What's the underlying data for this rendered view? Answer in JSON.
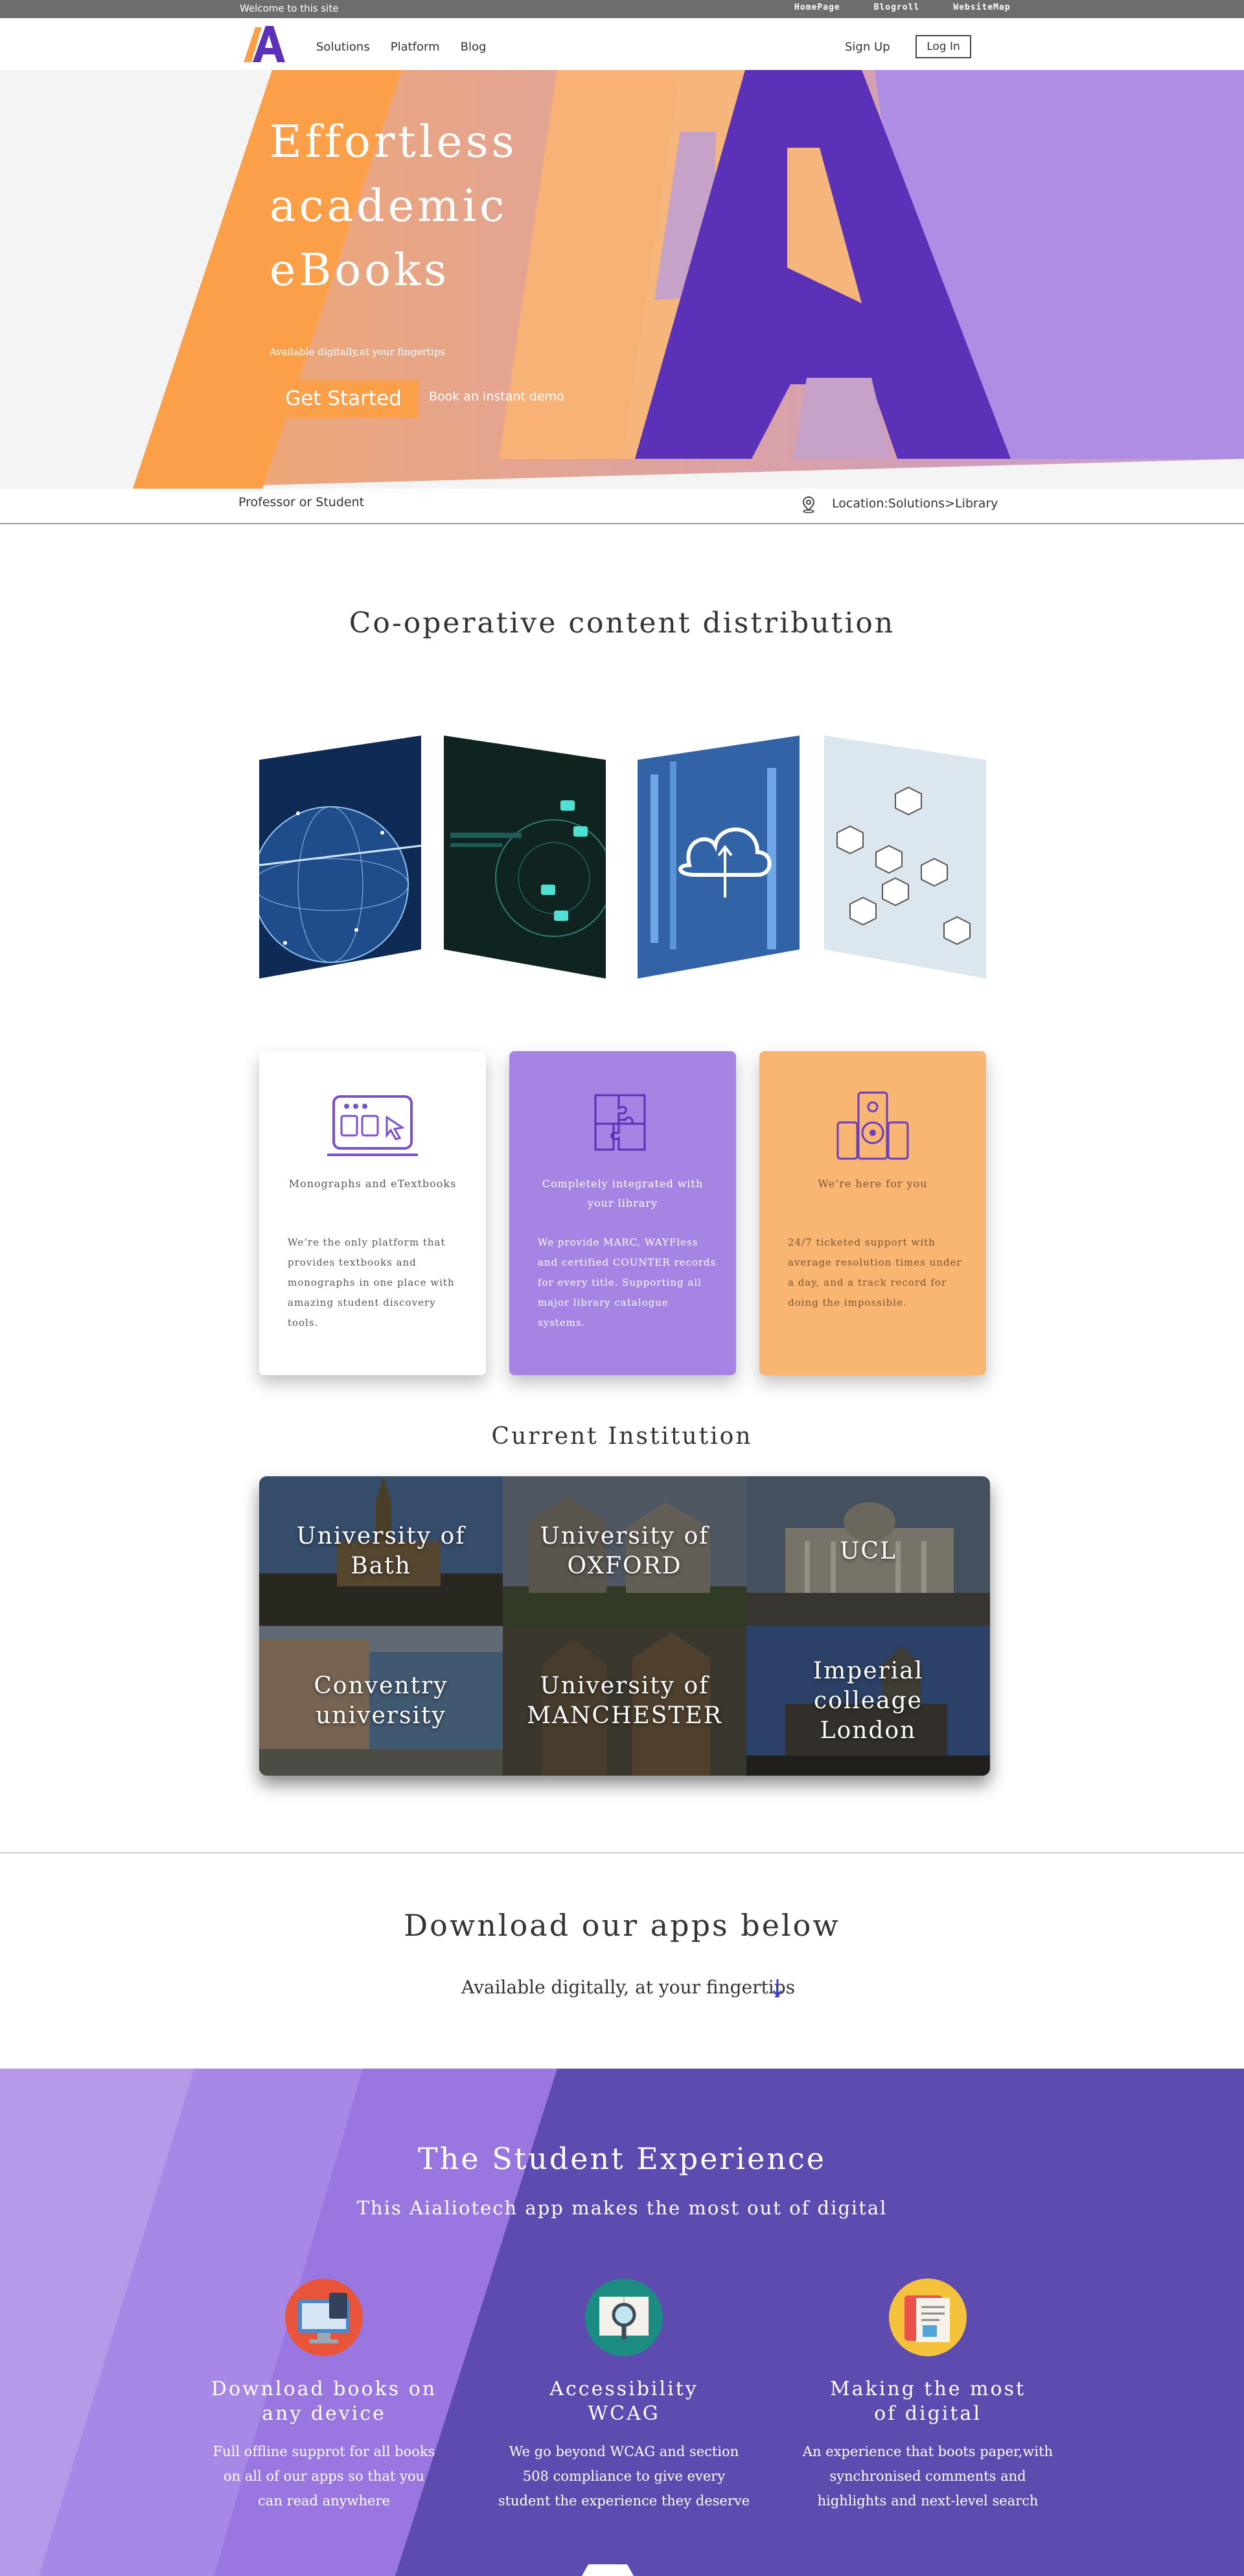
{
  "topbar": {
    "welcome": "Welcome to this site",
    "links": [
      "HomePage",
      "Blogroll",
      "WebsiteMap"
    ]
  },
  "nav": {
    "links": [
      "Solutions",
      "Platform",
      "Blog"
    ],
    "signup": "Sign Up",
    "login": "Log In"
  },
  "hero": {
    "title": "Effortless academic eBooks",
    "subtitle": "Available digitally,at your fingertips",
    "cta_primary": "Get Started",
    "cta_secondary": "Book an instant demo"
  },
  "location_bar": {
    "role": "Professor or Student",
    "location": "Location:Solutions>Library",
    "icon": "location-pin-icon"
  },
  "cooperative": {
    "title": "Co-operative content distribution"
  },
  "cards": [
    {
      "title": "Monographs and eTextbooks",
      "text": "We’re the only platform that provides textbooks and monographs in one place with amazing student discovery tools.",
      "icon": "device-browser-icon"
    },
    {
      "title": "Completely integrated with your library",
      "text": "We provide MARC, WAYFless and certified COUNTER records for every title. Supporting all major library catalogue systems.",
      "icon": "puzzle-icon"
    },
    {
      "title": "We’re here for you",
      "text": "24/7 ticketed support with average resolution times under a day, and a track record for doing the impossible.",
      "icon": "speaker-icon"
    }
  ],
  "institutions": {
    "title": "Current Institution",
    "items": [
      "University of\nBath",
      "University of\nOXFORD",
      "UCL",
      "Conventry\nuniversity",
      "University of\nMANCHESTER",
      "Imperial colleage\nLondon"
    ]
  },
  "download": {
    "title": "Download our apps below",
    "subtitle": "Available digitally, at your fingertips",
    "icon": "arrow-down-icon"
  },
  "student": {
    "title": "The Student Experience",
    "subtitle": "This Aialiotech app makes the most out of digital",
    "features": [
      {
        "title": "Download books on\nany device",
        "text": "Full offline supprot for all books\non all of our apps so that you\ncan read anywhere",
        "icon": "computer-icon"
      },
      {
        "title": "Accessibility\nWCAG",
        "text": "We go beyond WCAG and section\n508 compliance to give every\nstudent the experience they deserve",
        "icon": "magnifier-book-icon"
      },
      {
        "title": "Making the most\nof digital",
        "text": "An experience that boots paper,with\nsynchronised comments and\nhighlights and next-level search",
        "icon": "tablet-doc-icon"
      }
    ]
  },
  "colors": {
    "orange": "#fb9f48",
    "purple": "#5b31b8",
    "lavender": "#ad8ee4",
    "peach": "#f9b673"
  }
}
